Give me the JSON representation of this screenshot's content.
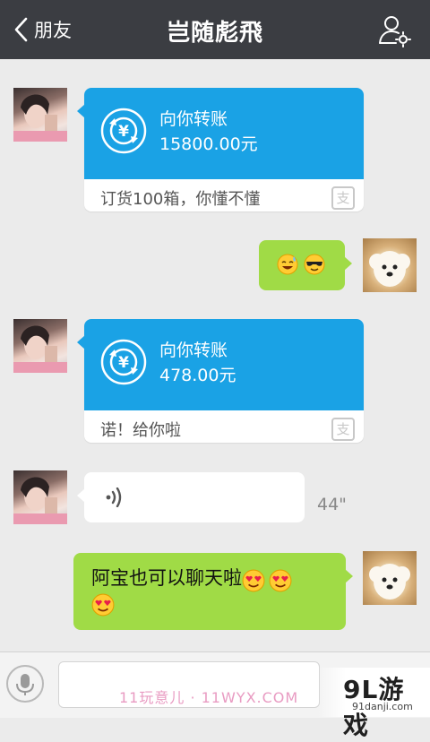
{
  "header": {
    "back_label": "朋友",
    "title": "岂随彪飛"
  },
  "messages": [
    {
      "type": "transfer",
      "side": "left",
      "title": "向你转账",
      "amount": "15800.00元",
      "note": "订货100箱，你懂不懂",
      "badge": "支"
    },
    {
      "type": "emoji",
      "side": "right",
      "emojis": [
        "sweat-smile-emoji",
        "cool-sunglasses-emoji"
      ]
    },
    {
      "type": "transfer",
      "side": "left",
      "title": "向你转账",
      "amount": "478.00元",
      "note": "诺！给你啦",
      "badge": "支"
    },
    {
      "type": "voice",
      "side": "left",
      "duration": "44\""
    },
    {
      "type": "text",
      "side": "right",
      "text": "阿宝也可以聊天啦",
      "emojis": [
        "heart-eyes-emoji",
        "heart-eyes-emoji",
        "heart-eyes-emoji"
      ]
    }
  ],
  "watermark": {
    "text": "11玩意儿 · 11WYX.COM",
    "logo": "9L游戏",
    "logo_url": "91danji.com"
  },
  "colors": {
    "header_bg": "#3b3d42",
    "transfer_blue": "#1aa2e5",
    "bubble_green": "#a0db46",
    "background": "#ebebeb"
  }
}
